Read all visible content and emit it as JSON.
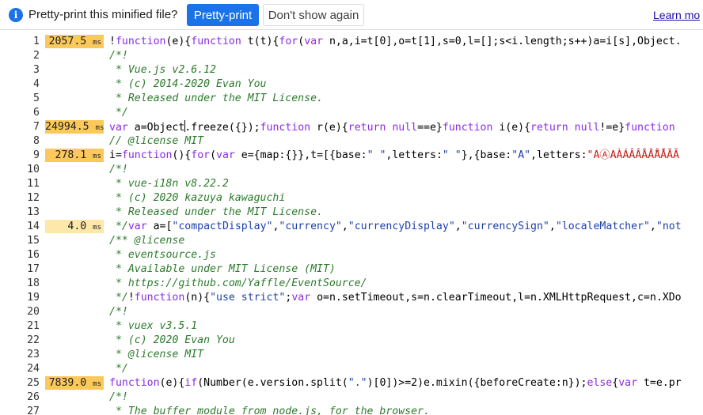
{
  "notification": {
    "icon": "info-icon",
    "message": "Pretty-print this minified file?",
    "pretty_print_label": "Pretty-print",
    "dont_show_label": "Don't show again",
    "learn_more_label": "Learn mo"
  },
  "colors": {
    "primary_button": "#1a73e8",
    "timing_hot": "#fbc85a",
    "timing_warm": "#fde7a9",
    "comment": "#2d7a2d",
    "keyword": "#8a2be2",
    "string": "#1c3faa"
  },
  "editor": {
    "lines": [
      {
        "num": "1",
        "time": "2057.5",
        "unit": "ms",
        "heat": "hot",
        "segments": [
          {
            "t": "!",
            "c": ""
          },
          {
            "t": "function",
            "c": "kw"
          },
          {
            "t": "(e){",
            "c": ""
          },
          {
            "t": "function",
            "c": "kw"
          },
          {
            "t": " t(t){",
            "c": ""
          },
          {
            "t": "for",
            "c": "kw"
          },
          {
            "t": "(",
            "c": ""
          },
          {
            "t": "var",
            "c": "kw"
          },
          {
            "t": " n,a,i=t[0],o=t[1],s=0,l=[];s<i.length;s++)a=i[s],Object.",
            "c": ""
          }
        ]
      },
      {
        "num": "2",
        "time": "",
        "unit": "",
        "heat": "",
        "segments": [
          {
            "t": "/*!",
            "c": "cm"
          }
        ]
      },
      {
        "num": "3",
        "time": "",
        "unit": "",
        "heat": "",
        "segments": [
          {
            "t": " * Vue.js v2.6.12",
            "c": "cm"
          }
        ]
      },
      {
        "num": "4",
        "time": "",
        "unit": "",
        "heat": "",
        "segments": [
          {
            "t": " * (c) 2014-2020 Evan You",
            "c": "cm"
          }
        ]
      },
      {
        "num": "5",
        "time": "",
        "unit": "",
        "heat": "",
        "segments": [
          {
            "t": " * Released under the MIT License.",
            "c": "cm"
          }
        ]
      },
      {
        "num": "6",
        "time": "",
        "unit": "",
        "heat": "",
        "segments": [
          {
            "t": " */",
            "c": "cm"
          }
        ]
      },
      {
        "num": "7",
        "time": "24994.5",
        "unit": "ms",
        "heat": "hot",
        "cursor_after": 2,
        "segments": [
          {
            "t": "var",
            "c": "kw"
          },
          {
            "t": " a=",
            "c": ""
          },
          {
            "t": "Object",
            "c": ""
          },
          {
            "t": ".freeze({});",
            "c": ""
          },
          {
            "t": "function",
            "c": "kw"
          },
          {
            "t": " r(e){",
            "c": ""
          },
          {
            "t": "return",
            "c": "kw"
          },
          {
            "t": " ",
            "c": ""
          },
          {
            "t": "null",
            "c": "kw"
          },
          {
            "t": "==e}",
            "c": ""
          },
          {
            "t": "function",
            "c": "kw"
          },
          {
            "t": " i(e){",
            "c": ""
          },
          {
            "t": "return",
            "c": "kw"
          },
          {
            "t": " ",
            "c": ""
          },
          {
            "t": "null",
            "c": "kw"
          },
          {
            "t": "!=e}",
            "c": ""
          },
          {
            "t": "function",
            "c": "kw"
          }
        ]
      },
      {
        "num": "8",
        "time": "",
        "unit": "",
        "heat": "",
        "segments": [
          {
            "t": "// @license MIT",
            "c": "cm"
          }
        ]
      },
      {
        "num": "9",
        "time": "278.1",
        "unit": "ms",
        "heat": "hot",
        "segments": [
          {
            "t": "i=",
            "c": ""
          },
          {
            "t": "function",
            "c": "kw"
          },
          {
            "t": "(){",
            "c": ""
          },
          {
            "t": "for",
            "c": "kw"
          },
          {
            "t": "(",
            "c": ""
          },
          {
            "t": "var",
            "c": "kw"
          },
          {
            "t": " e={map:{}},t=[{base:",
            "c": ""
          },
          {
            "t": "\" \"",
            "c": "st"
          },
          {
            "t": ",letters:",
            "c": ""
          },
          {
            "t": "\" \"",
            "c": "st"
          },
          {
            "t": "},{base:",
            "c": ""
          },
          {
            "t": "\"A\"",
            "c": "st"
          },
          {
            "t": ",letters:",
            "c": ""
          },
          {
            "t": "\"AⒶAÀÁÂẦẤẪẨÃĀĂ",
            "c": "rd"
          }
        ]
      },
      {
        "num": "10",
        "time": "",
        "unit": "",
        "heat": "",
        "segments": [
          {
            "t": "/*!",
            "c": "cm"
          }
        ]
      },
      {
        "num": "11",
        "time": "",
        "unit": "",
        "heat": "",
        "segments": [
          {
            "t": " * vue-i18n v8.22.2",
            "c": "cm"
          }
        ]
      },
      {
        "num": "12",
        "time": "",
        "unit": "",
        "heat": "",
        "segments": [
          {
            "t": " * (c) 2020 kazuya kawaguchi",
            "c": "cm"
          }
        ]
      },
      {
        "num": "13",
        "time": "",
        "unit": "",
        "heat": "",
        "segments": [
          {
            "t": " * Released under the MIT License.",
            "c": "cm"
          }
        ]
      },
      {
        "num": "14",
        "time": "4.0",
        "unit": "ms",
        "heat": "warm",
        "segments": [
          {
            "t": " */",
            "c": "cm"
          },
          {
            "t": "var",
            "c": "kw"
          },
          {
            "t": " a=[",
            "c": ""
          },
          {
            "t": "\"compactDisplay\"",
            "c": "st"
          },
          {
            "t": ",",
            "c": ""
          },
          {
            "t": "\"currency\"",
            "c": "st"
          },
          {
            "t": ",",
            "c": ""
          },
          {
            "t": "\"currencyDisplay\"",
            "c": "st"
          },
          {
            "t": ",",
            "c": ""
          },
          {
            "t": "\"currencySign\"",
            "c": "st"
          },
          {
            "t": ",",
            "c": ""
          },
          {
            "t": "\"localeMatcher\"",
            "c": "st"
          },
          {
            "t": ",",
            "c": ""
          },
          {
            "t": "\"not",
            "c": "st"
          }
        ]
      },
      {
        "num": "15",
        "time": "",
        "unit": "",
        "heat": "",
        "segments": [
          {
            "t": "/** @license",
            "c": "cm"
          }
        ]
      },
      {
        "num": "16",
        "time": "",
        "unit": "",
        "heat": "",
        "segments": [
          {
            "t": " * eventsource.js",
            "c": "cm"
          }
        ]
      },
      {
        "num": "17",
        "time": "",
        "unit": "",
        "heat": "",
        "segments": [
          {
            "t": " * Available under MIT License (MIT)",
            "c": "cm"
          }
        ]
      },
      {
        "num": "18",
        "time": "",
        "unit": "",
        "heat": "",
        "segments": [
          {
            "t": " * https://github.com/Yaffle/EventSource/",
            "c": "cm"
          }
        ]
      },
      {
        "num": "19",
        "time": "",
        "unit": "",
        "heat": "",
        "segments": [
          {
            "t": " */",
            "c": "cm"
          },
          {
            "t": "!",
            "c": ""
          },
          {
            "t": "function",
            "c": "kw"
          },
          {
            "t": "(n){",
            "c": ""
          },
          {
            "t": "\"use strict\"",
            "c": "st"
          },
          {
            "t": ";",
            "c": ""
          },
          {
            "t": "var",
            "c": "kw"
          },
          {
            "t": " o=n.setTimeout,s=n.clearTimeout,l=n.XMLHttpRequest,c=n.XDo",
            "c": ""
          }
        ]
      },
      {
        "num": "20",
        "time": "",
        "unit": "",
        "heat": "",
        "segments": [
          {
            "t": "/*!",
            "c": "cm"
          }
        ]
      },
      {
        "num": "21",
        "time": "",
        "unit": "",
        "heat": "",
        "segments": [
          {
            "t": " * vuex v3.5.1",
            "c": "cm"
          }
        ]
      },
      {
        "num": "22",
        "time": "",
        "unit": "",
        "heat": "",
        "segments": [
          {
            "t": " * (c) 2020 Evan You",
            "c": "cm"
          }
        ]
      },
      {
        "num": "23",
        "time": "",
        "unit": "",
        "heat": "",
        "segments": [
          {
            "t": " * @license MIT",
            "c": "cm"
          }
        ]
      },
      {
        "num": "24",
        "time": "",
        "unit": "",
        "heat": "",
        "segments": [
          {
            "t": " */",
            "c": "cm"
          }
        ]
      },
      {
        "num": "25",
        "time": "7839.0",
        "unit": "ms",
        "heat": "hot",
        "segments": [
          {
            "t": "function",
            "c": "kw"
          },
          {
            "t": "(e){",
            "c": ""
          },
          {
            "t": "if",
            "c": "kw"
          },
          {
            "t": "(Number(e.version.split(",
            "c": ""
          },
          {
            "t": "\".\"",
            "c": "st"
          },
          {
            "t": ")[0])>=2)e.mixin({beforeCreate:n});",
            "c": ""
          },
          {
            "t": "else",
            "c": "kw"
          },
          {
            "t": "{",
            "c": ""
          },
          {
            "t": "var",
            "c": "kw"
          },
          {
            "t": " t=e.pr",
            "c": ""
          }
        ]
      },
      {
        "num": "26",
        "time": "",
        "unit": "",
        "heat": "",
        "segments": [
          {
            "t": "/*!",
            "c": "cm"
          }
        ]
      },
      {
        "num": "27",
        "time": "",
        "unit": "",
        "heat": "",
        "segments": [
          {
            "t": " * The buffer module from node.js, for the browser.",
            "c": "cm"
          }
        ]
      }
    ]
  }
}
